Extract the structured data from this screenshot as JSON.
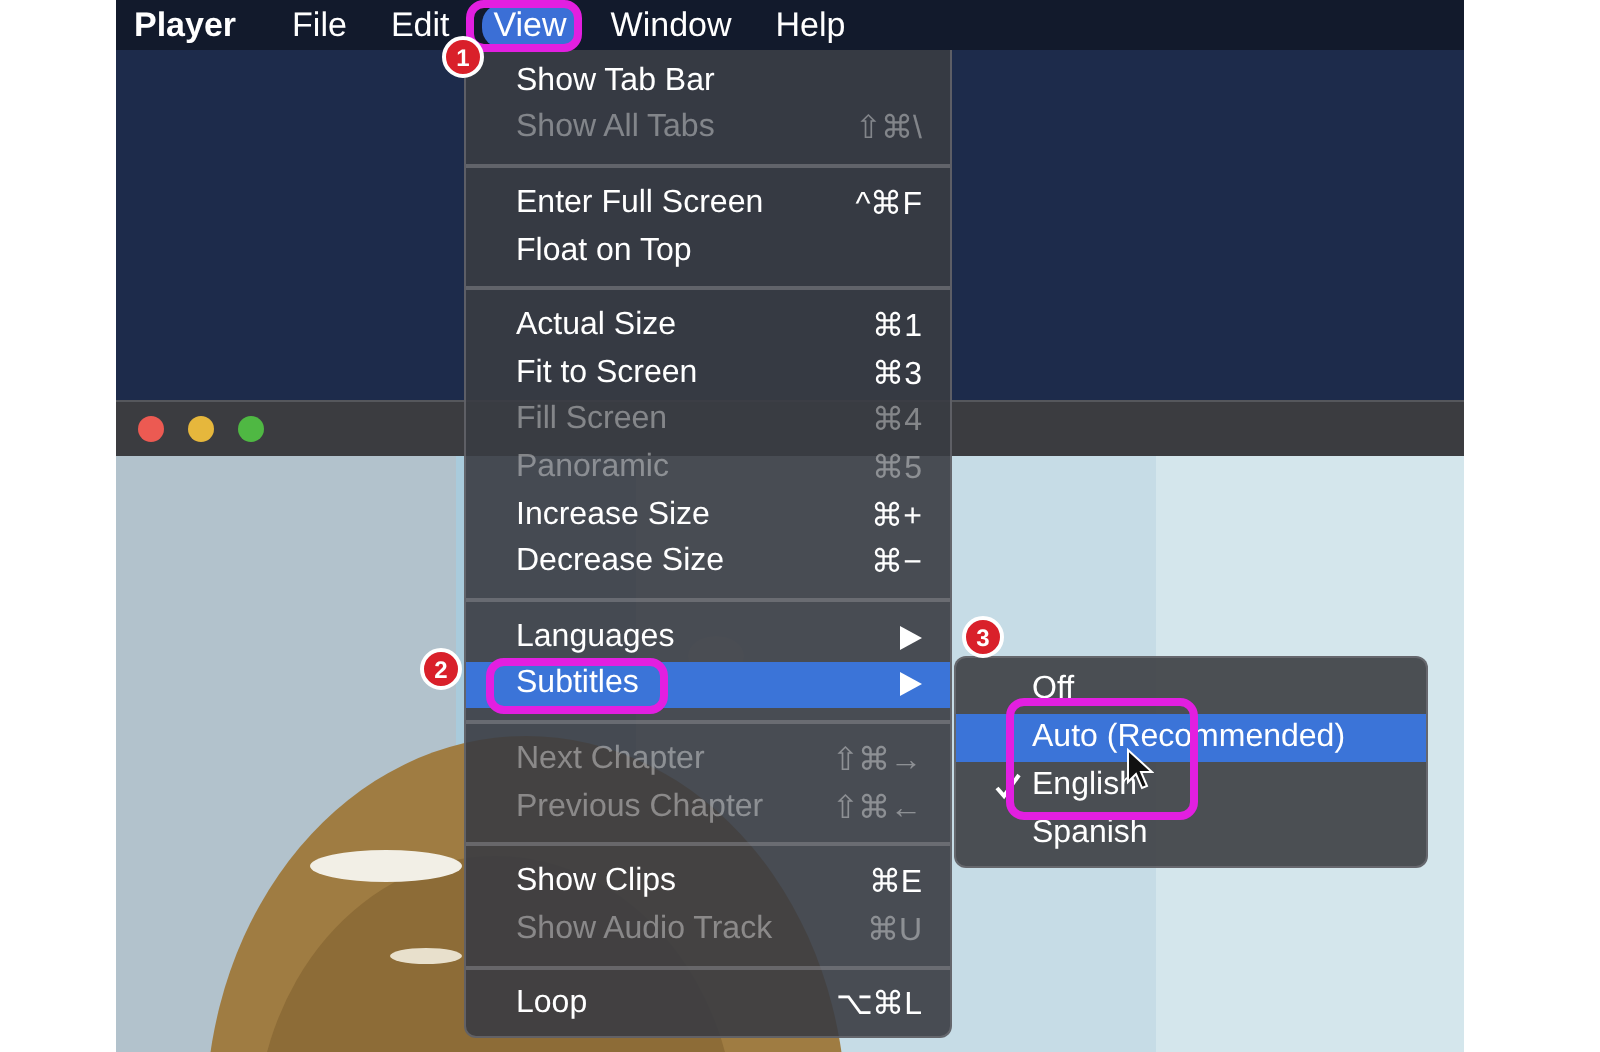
{
  "menu_bar": {
    "items": [
      {
        "label": "Player",
        "selected": false,
        "kind": "app"
      },
      {
        "label": "File",
        "selected": false,
        "kind": "menu"
      },
      {
        "label": "Edit",
        "selected": false,
        "kind": "menu"
      },
      {
        "label": "View",
        "selected": true,
        "kind": "menu",
        "callout": "1"
      },
      {
        "label": "Window",
        "selected": false,
        "kind": "menu"
      },
      {
        "label": "Help",
        "selected": false,
        "kind": "menu"
      }
    ]
  },
  "view_menu": {
    "groups": [
      [
        {
          "label": "Show Tab Bar",
          "kind": "item",
          "disabled": false,
          "selected": false
        },
        {
          "label": "Show All Tabs",
          "kind": "item",
          "shortcut": "⇧⌘\\",
          "disabled": true,
          "selected": false
        }
      ],
      [
        {
          "label": "Enter Full Screen",
          "kind": "item",
          "shortcut": "^⌘F",
          "disabled": false,
          "selected": false
        },
        {
          "label": "Float on Top",
          "kind": "item",
          "disabled": false,
          "selected": false
        }
      ],
      [
        {
          "label": "Actual Size",
          "kind": "item",
          "shortcut": "⌘1",
          "disabled": false,
          "selected": false
        },
        {
          "label": "Fit to Screen",
          "kind": "item",
          "shortcut": "⌘3",
          "disabled": false,
          "selected": false
        },
        {
          "label": "Fill Screen",
          "kind": "item",
          "shortcut": "⌘4",
          "disabled": true,
          "selected": false
        },
        {
          "label": "Panoramic",
          "kind": "item",
          "shortcut": "⌘5",
          "disabled": true,
          "selected": false
        },
        {
          "label": "Increase Size",
          "kind": "item",
          "shortcut": "⌘+",
          "disabled": false,
          "selected": false
        },
        {
          "label": "Decrease Size",
          "kind": "item",
          "shortcut": "⌘−",
          "disabled": false,
          "selected": false
        }
      ],
      [
        {
          "label": "Languages",
          "kind": "submenu",
          "disabled": false,
          "selected": false
        },
        {
          "label": "Subtitles",
          "kind": "submenu",
          "disabled": false,
          "selected": true,
          "callout": "2"
        }
      ],
      [
        {
          "label": "Next Chapter",
          "kind": "item",
          "shortcut": "⇧⌘→",
          "disabled": true,
          "selected": false
        },
        {
          "label": "Previous Chapter",
          "kind": "item",
          "shortcut": "⇧⌘←",
          "disabled": true,
          "selected": false
        }
      ],
      [
        {
          "label": "Show Clips",
          "kind": "item",
          "shortcut": "⌘E",
          "disabled": false,
          "selected": false
        },
        {
          "label": "Show Audio Track",
          "kind": "item",
          "shortcut": "⌘U",
          "disabled": true,
          "selected": false
        }
      ],
      [
        {
          "label": "Loop",
          "kind": "item",
          "shortcut": "⌥⌘L",
          "disabled": false,
          "selected": false
        }
      ]
    ]
  },
  "subtitles_menu": {
    "callout": "3",
    "items": [
      {
        "label": "Off",
        "checked": false,
        "selected": false,
        "framed": false
      },
      {
        "label": "Auto (Recommended)",
        "checked": false,
        "selected": true,
        "framed": true
      },
      {
        "label": "English",
        "checked": true,
        "selected": false,
        "framed": true
      },
      {
        "label": "Spanish",
        "checked": false,
        "selected": false,
        "framed": false
      }
    ]
  }
}
